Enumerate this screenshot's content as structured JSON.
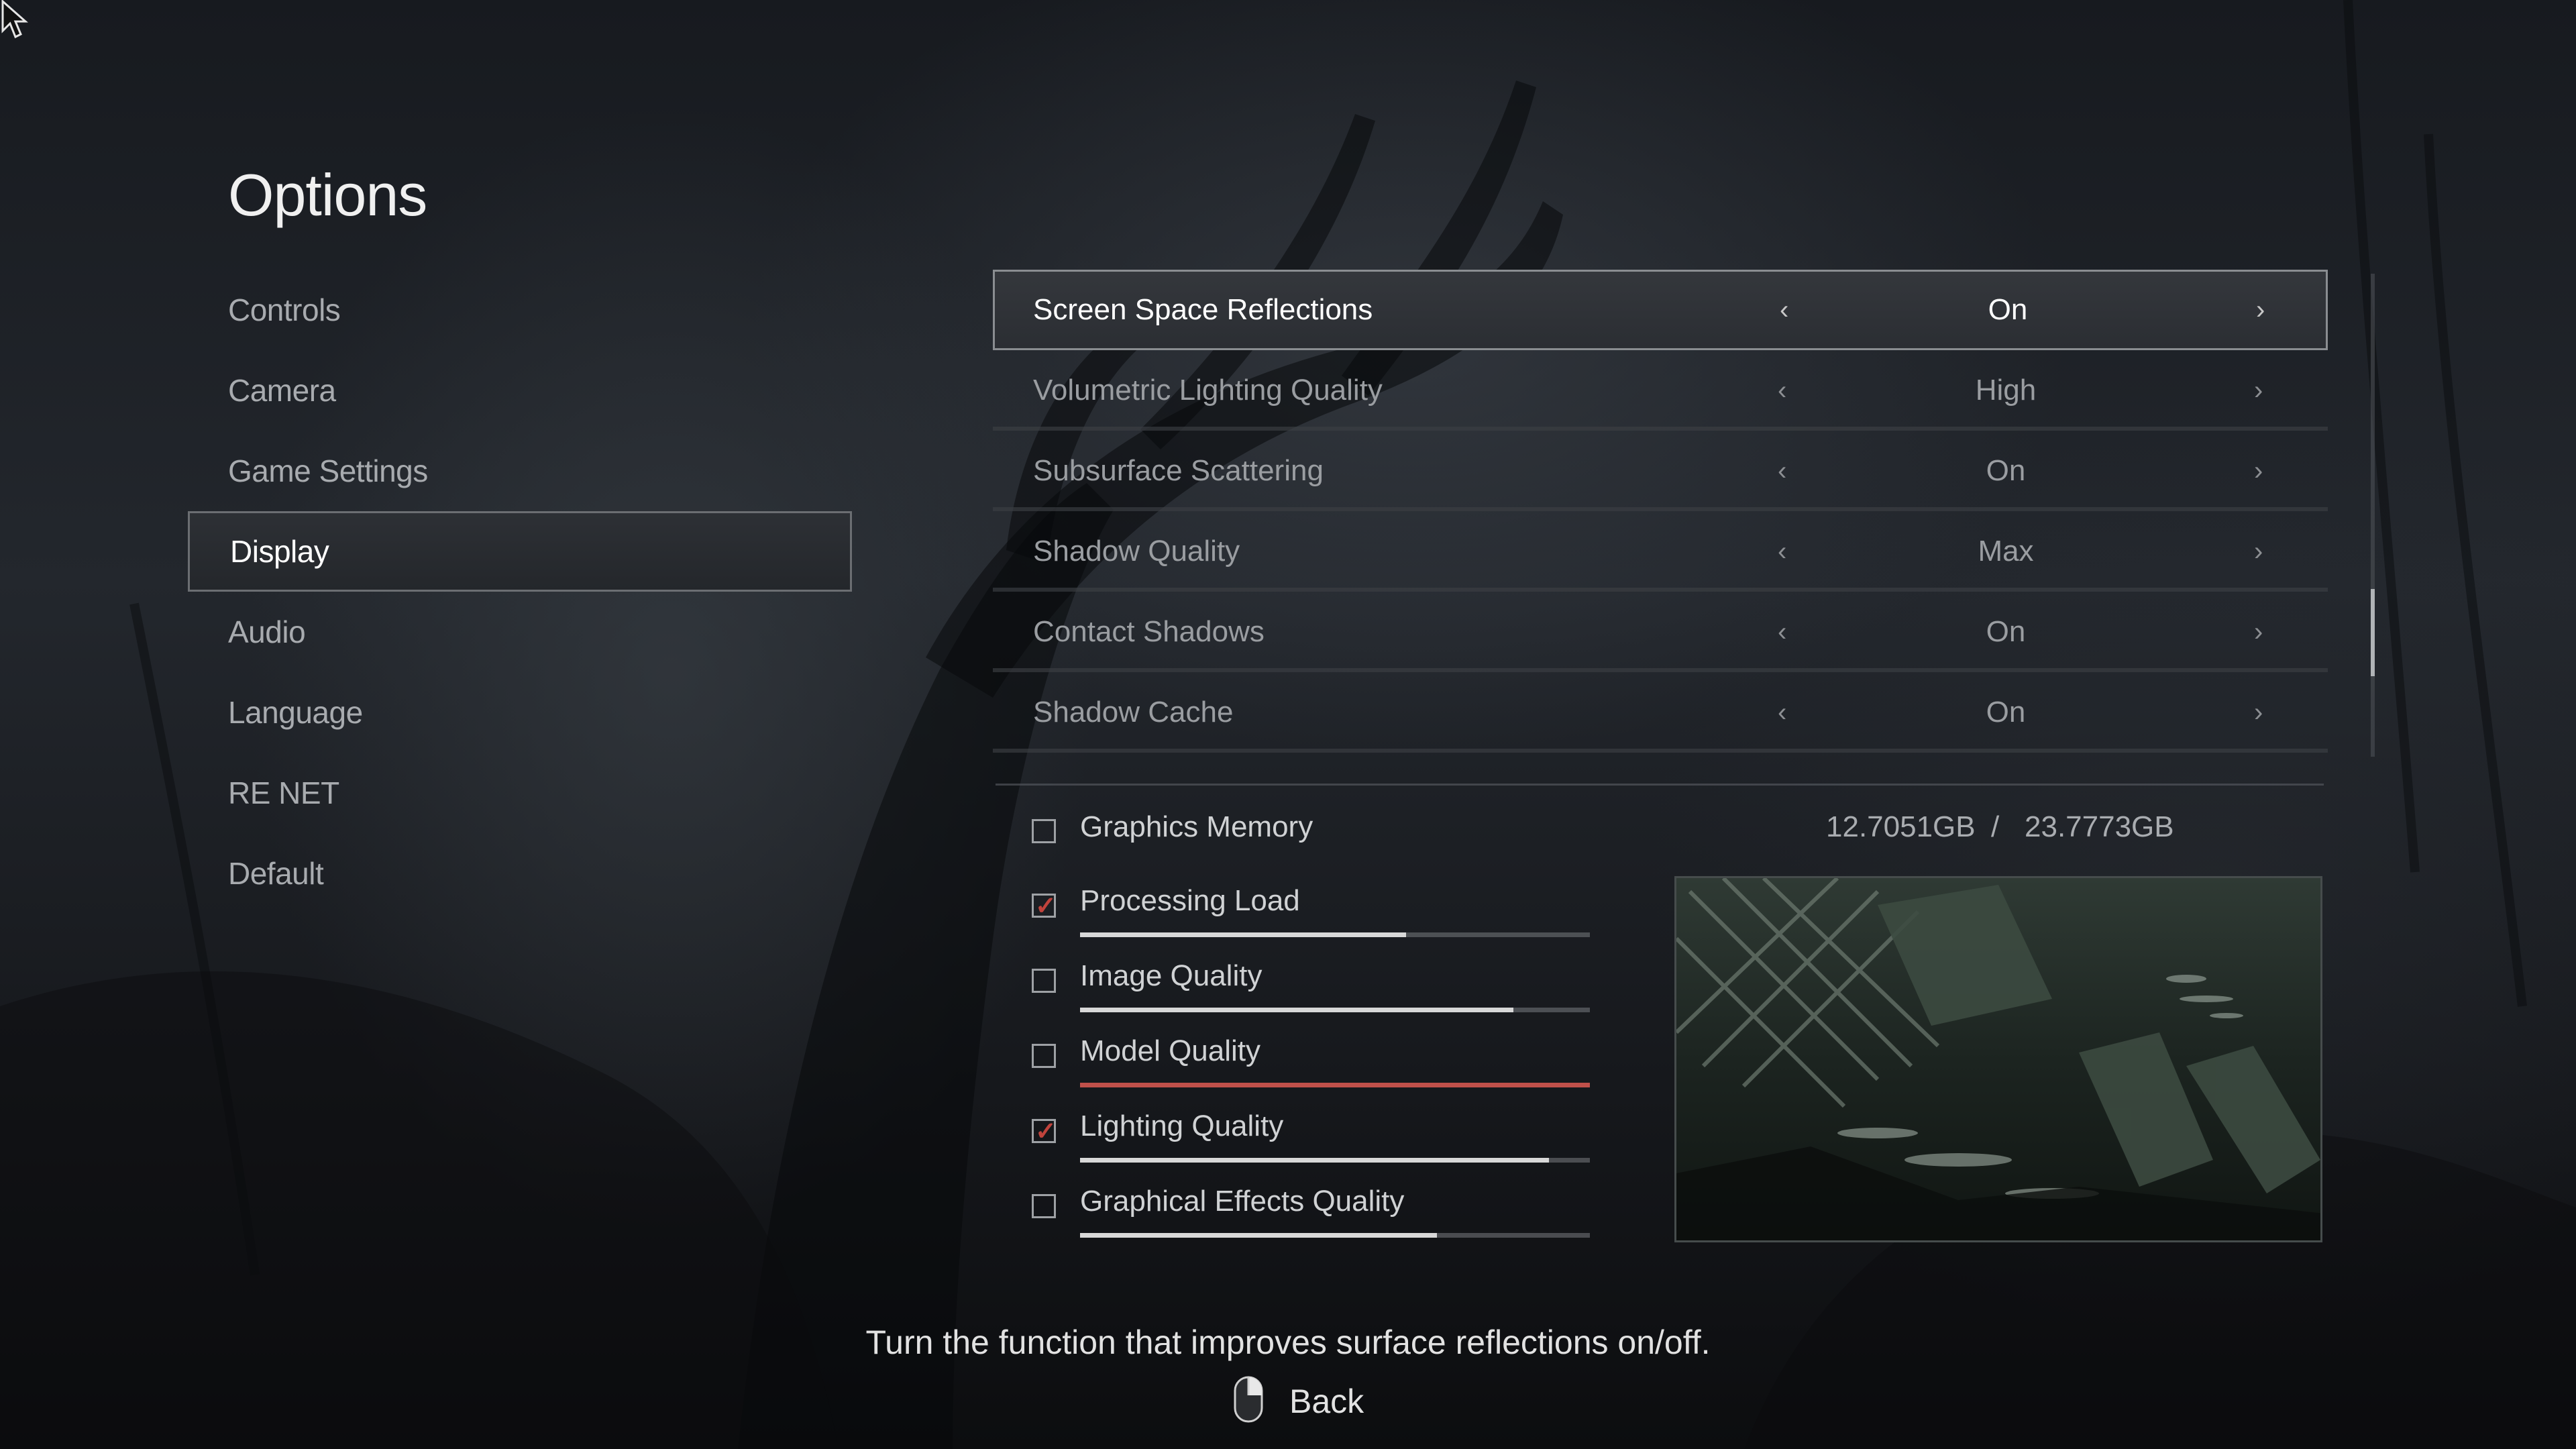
{
  "title": "Options",
  "menu": {
    "items": [
      {
        "label": "Controls"
      },
      {
        "label": "Camera"
      },
      {
        "label": "Game Settings"
      },
      {
        "label": "Display",
        "active": true
      },
      {
        "label": "Audio"
      },
      {
        "label": "Language"
      },
      {
        "label": "RE NET"
      },
      {
        "label": "Default"
      }
    ]
  },
  "settings": [
    {
      "label": "Screen Space Reflections",
      "value": "On",
      "selected": true
    },
    {
      "label": "Volumetric Lighting Quality",
      "value": "High"
    },
    {
      "label": "Subsurface Scattering",
      "value": "On"
    },
    {
      "label": "Shadow Quality",
      "value": "Max"
    },
    {
      "label": "Contact Shadows",
      "value": "On"
    },
    {
      "label": "Shadow Cache",
      "value": "On"
    }
  ],
  "arrows": {
    "left": "‹",
    "right": "›"
  },
  "graphics_memory": {
    "label": "Graphics Memory",
    "checked": false,
    "used": "12.7051GB",
    "separator": "/",
    "total": "23.7773GB"
  },
  "meters": [
    {
      "label": "Processing Load",
      "checked": true,
      "fill_fraction": 0.64
    },
    {
      "label": "Image Quality",
      "checked": false,
      "fill_fraction": 0.85
    },
    {
      "label": "Model Quality",
      "checked": false,
      "fill_fraction": 1.0,
      "over_budget": true
    },
    {
      "label": "Lighting Quality",
      "checked": true,
      "fill_fraction": 0.92
    },
    {
      "label": "Graphical Effects Quality",
      "checked": false,
      "fill_fraction": 0.7
    }
  ],
  "check_glyph": "✓",
  "description": "Turn the function that improves surface reflections on/off.",
  "footer": {
    "back_label": "Back",
    "back_icon": "mouse-icon"
  },
  "colors": {
    "accent_red": "#c0433c",
    "highlight_border": "#8a8d91"
  }
}
